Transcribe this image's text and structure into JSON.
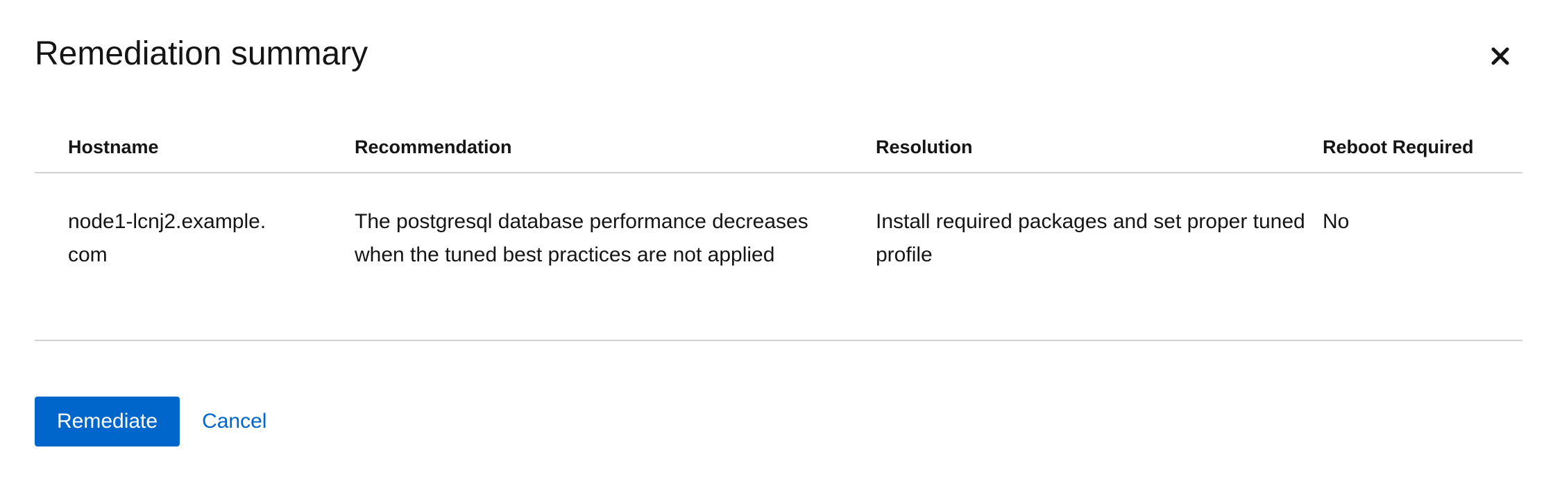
{
  "modal": {
    "title": "Remediation summary",
    "close_icon": "close-icon"
  },
  "table": {
    "columns": [
      "Hostname",
      "Recommendation",
      "Resolution",
      "Reboot Required"
    ],
    "rows": [
      {
        "hostname": "node1-lcnj2.example.com",
        "recommendation": "The postgresql database performance decreases when the tuned best practices are not applied",
        "resolution": "Install required packages and set proper tuned profile",
        "reboot_required": "No"
      }
    ]
  },
  "actions": {
    "remediate_label": "Remediate",
    "cancel_label": "Cancel"
  },
  "colors": {
    "primary": "#0066cc",
    "text": "#151515",
    "divider": "#d2d2d2"
  }
}
